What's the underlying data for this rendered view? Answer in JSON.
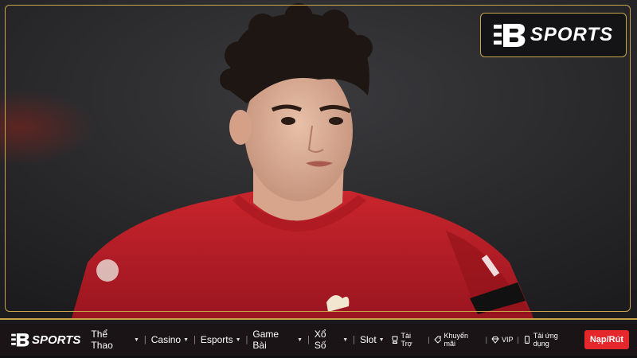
{
  "brand": {
    "name": "SPORTS",
    "accent": "#c8a54a",
    "cta_color": "#e3272a"
  },
  "hero": {
    "image_alt": "Liverpool player in red jersey"
  },
  "nav": {
    "menu": [
      {
        "label": "Thể Thao"
      },
      {
        "label": "Casino"
      },
      {
        "label": "Esports"
      },
      {
        "label": "Game Bài"
      },
      {
        "label": "Xổ Số"
      },
      {
        "label": "Slot"
      }
    ],
    "links": [
      {
        "label": "Tài Trợ",
        "icon": "trophy-icon"
      },
      {
        "label": "Khuyến mãi",
        "icon": "tag-icon"
      },
      {
        "label": "VIP",
        "icon": "diamond-icon"
      },
      {
        "label": "Tải ứng dụng",
        "icon": "phone-icon"
      }
    ],
    "cta": "Nạp/Rút"
  }
}
